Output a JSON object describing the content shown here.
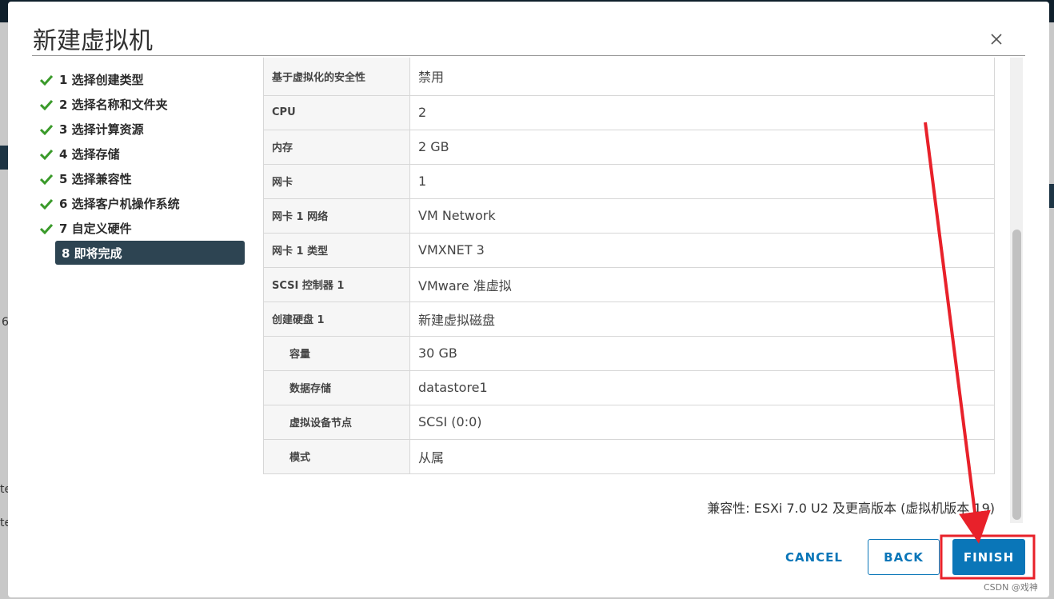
{
  "background": {
    "fragments": [
      "6",
      "te",
      "te"
    ]
  },
  "dialog": {
    "title": "新建虚拟机",
    "close_icon": "close-icon"
  },
  "steps": [
    {
      "label": "1 选择创建类型",
      "done": true
    },
    {
      "label": "2 选择名称和文件夹",
      "done": true
    },
    {
      "label": "3 选择计算资源",
      "done": true
    },
    {
      "label": "4 选择存储",
      "done": true
    },
    {
      "label": "5 选择兼容性",
      "done": true
    },
    {
      "label": "6 选择客户机操作系统",
      "done": true
    },
    {
      "label": "7 自定义硬件",
      "done": true
    },
    {
      "label": "8 即将完成",
      "done": false,
      "active": true
    }
  ],
  "review_rows": [
    {
      "label": "基于虚拟化的安全性",
      "value": "禁用",
      "indent": false
    },
    {
      "label": "CPU",
      "value": "2",
      "indent": false
    },
    {
      "label": "内存",
      "value": "2 GB",
      "indent": false
    },
    {
      "label": "网卡",
      "value": "1",
      "indent": false
    },
    {
      "label": "网卡 1 网络",
      "value": "VM Network",
      "indent": false
    },
    {
      "label": "网卡 1 类型",
      "value": "VMXNET 3",
      "indent": false
    },
    {
      "label": "SCSI 控制器 1",
      "value": "VMware 准虚拟",
      "indent": false
    },
    {
      "label": "创建硬盘 1",
      "value": "新建虚拟磁盘",
      "indent": false
    },
    {
      "label": "容量",
      "value": "30 GB",
      "indent": true
    },
    {
      "label": "数据存储",
      "value": "datastore1",
      "indent": true
    },
    {
      "label": "虚拟设备节点",
      "value": "SCSI (0:0)",
      "indent": true
    },
    {
      "label": "模式",
      "value": "从属",
      "indent": true
    }
  ],
  "compatibility": "兼容性: ESXi 7.0 U2 及更高版本 (虚拟机版本 19)",
  "buttons": {
    "cancel": "CANCEL",
    "back": "BACK",
    "finish": "FINISH"
  },
  "colors": {
    "accent": "#0a76b8",
    "check": "#3a9a2a",
    "active_step": "#2d4452",
    "annotation": "#e8212a"
  },
  "watermark": "CSDN @戏神"
}
